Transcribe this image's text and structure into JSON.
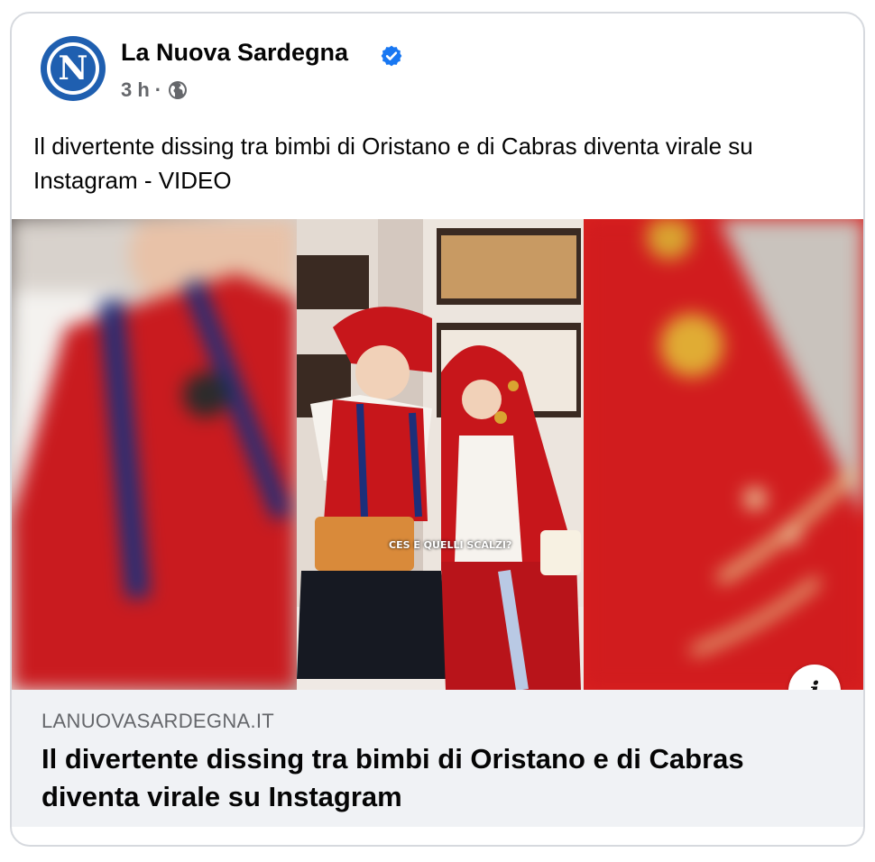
{
  "post": {
    "page_name": "La Nuova Sardegna",
    "avatar_letter": "N",
    "time": "3 h",
    "separator": "·",
    "text": "Il divertente dissing tra bimbi di Oristano e di Cabras diventa virale su Instagram - VIDEO"
  },
  "media": {
    "caption": "CES E QUELLI SCALZI?"
  },
  "link_preview": {
    "domain": "LANUOVASARDEGNA.IT",
    "title": "Il divertente dissing tra bimbi di Oristano e di Cabras diventa virale su Instagram"
  },
  "info_button": {
    "glyph": "i"
  },
  "colors": {
    "brand_blue": "#1f5fb0",
    "verified_blue": "#1877f2",
    "costume_red": "#d9201f",
    "preview_bg": "#f0f2f5"
  },
  "icons": [
    "verified-badge-icon",
    "globe-icon",
    "info-icon"
  ]
}
